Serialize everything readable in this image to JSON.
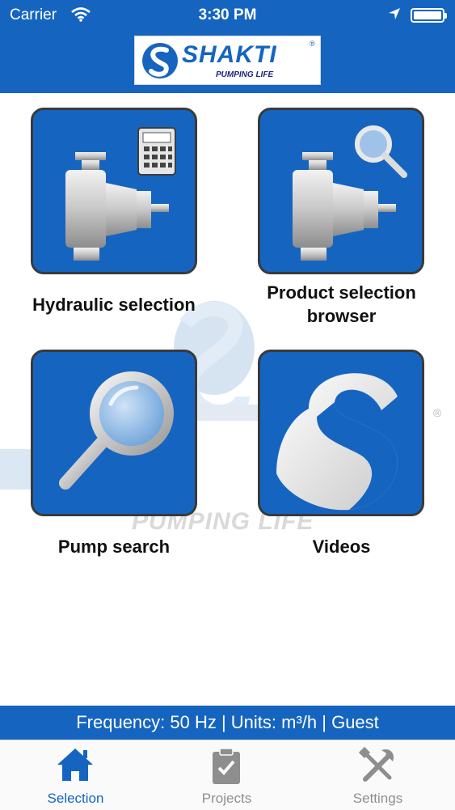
{
  "status_bar": {
    "carrier": "Carrier",
    "time": "3:30 PM"
  },
  "header": {
    "logo_text": "SHAKTI",
    "logo_tagline": "PUMPING LIFE",
    "logo_mark": "®"
  },
  "watermark": {
    "text": "PUMPING LIFE",
    "mark": "®"
  },
  "tiles": [
    {
      "label_lines": [
        "Hydraulic selection"
      ],
      "icon": "pump-calculator-icon"
    },
    {
      "label_lines": [
        "Product selection",
        "browser"
      ],
      "icon": "pump-magnifier-icon"
    },
    {
      "label_lines": [
        "Pump search"
      ],
      "icon": "magnifier-icon"
    },
    {
      "label_lines": [
        "Videos"
      ],
      "icon": "shakti-s-logo-icon"
    }
  ],
  "info_bar": {
    "text": "Frequency: 50 Hz | Units: m³/h | Guest"
  },
  "tabbar": {
    "items": [
      {
        "label": "Selection",
        "icon": "home-icon",
        "active": true
      },
      {
        "label": "Projects",
        "icon": "clipboard-icon",
        "active": false
      },
      {
        "label": "Settings",
        "icon": "tools-icon",
        "active": false
      }
    ]
  },
  "colors": {
    "brand_blue": "#1565c0",
    "tab_active": "#1565c0",
    "tab_inactive": "#8e8e8e"
  }
}
